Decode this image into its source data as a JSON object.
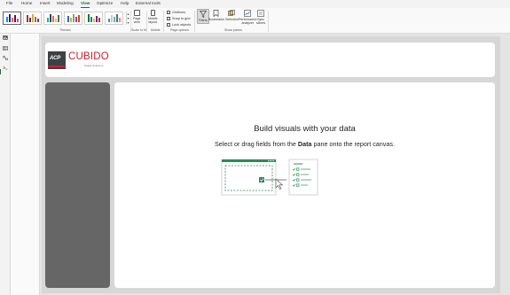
{
  "menu": {
    "items": [
      "File",
      "Home",
      "Insert",
      "Modeling",
      "View",
      "Optimize",
      "Help",
      "External tools"
    ],
    "active": "View"
  },
  "ribbon": {
    "groups": {
      "themes": "Themes",
      "scale_to_fit": "Scale to fit",
      "mobile": "Mobile",
      "page_options": "Page options",
      "show_panes": "Show panes"
    },
    "page_view_label": "Page\nview",
    "mobile_layout_label": "Mobile\nlayout",
    "checkboxes": [
      "Gridlines",
      "Snap to grid",
      "Lock objects"
    ],
    "panes": [
      "Filters",
      "Bookmarks",
      "Selection",
      "Performance\nanalyzer",
      "Sync\nslicers"
    ],
    "selected_pane": "Filters"
  },
  "header": {
    "logo_badge": "ACP",
    "logo_text": "CUBIDO",
    "logo_tagline": "Digital Solutions"
  },
  "canvas": {
    "title": "Build visuals with your data",
    "subtitle_before": "Select or drag fields from the ",
    "subtitle_bold": "Data",
    "subtitle_after": " pane onto the report canvas."
  },
  "colors": {
    "accent_green": "#1f6d3b",
    "brand_red": "#c8232c",
    "slicer_gray": "#666666",
    "illustration_green": "#2e8b57"
  },
  "icons": [
    "report-view-icon",
    "table-view-icon",
    "model-view-icon",
    "dax-query-icon"
  ]
}
